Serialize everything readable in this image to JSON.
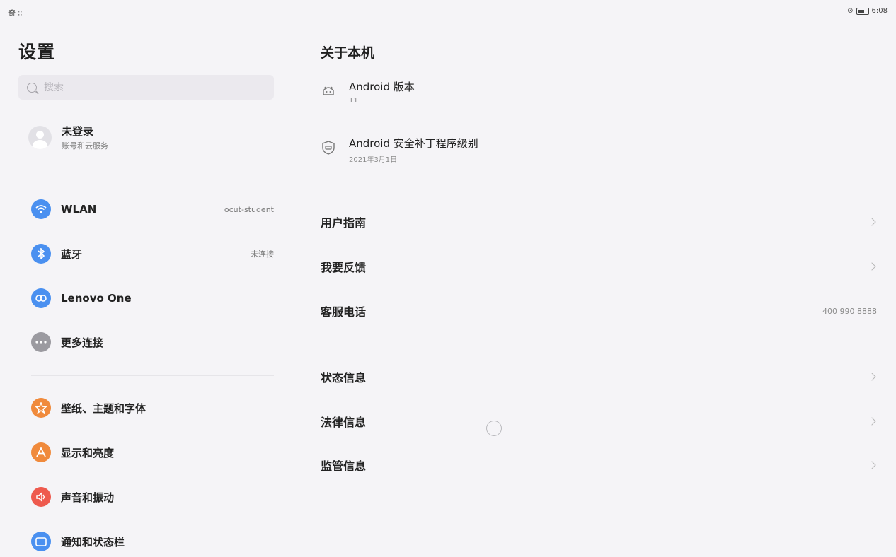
{
  "status_bar": {
    "left_text": "奇 ⁝⁝",
    "right_text": "6:08"
  },
  "left_pane": {
    "title": "设置",
    "search": {
      "placeholder": "搜索"
    },
    "account": {
      "name": "未登录",
      "subtitle": "账号和云服务"
    },
    "items": [
      {
        "label": "WLAN",
        "value": "ocut-student",
        "icon": "wifi-icon",
        "color": "#4a90f0"
      },
      {
        "label": "蓝牙",
        "value": "未连接",
        "icon": "bluetooth-icon",
        "color": "#4a90f0"
      },
      {
        "label": "Lenovo One",
        "value": "",
        "icon": "lenovo-one-icon",
        "color": "#4a90f0"
      },
      {
        "label": "更多连接",
        "value": "",
        "icon": "more-icon",
        "color": "#9b9aa0"
      },
      {
        "label": "壁纸、主题和字体",
        "value": "",
        "icon": "theme-icon",
        "color": "#f08a3c"
      },
      {
        "label": "显示和亮度",
        "value": "",
        "icon": "display-icon",
        "color": "#f08a3c"
      },
      {
        "label": "声音和振动",
        "value": "",
        "icon": "sound-icon",
        "color": "#ee5a4e"
      },
      {
        "label": "通知和状态栏",
        "value": "",
        "icon": "notification-icon",
        "color": "#4a90f0"
      }
    ]
  },
  "right_pane": {
    "title": "关于本机",
    "info": [
      {
        "title": "Android 版本",
        "subtitle": "11",
        "icon": "android-icon"
      },
      {
        "title": "Android 安全补丁程序级别",
        "subtitle": "2021年3月1日",
        "icon": "shield-icon"
      }
    ],
    "rows": [
      {
        "label": "用户指南",
        "value": "",
        "has_chevron": true
      },
      {
        "label": "我要反馈",
        "value": "",
        "has_chevron": true
      },
      {
        "label": "客服电话",
        "value": "400 990 8888",
        "has_chevron": false
      },
      {
        "label": "状态信息",
        "value": "",
        "has_chevron": true
      },
      {
        "label": "法律信息",
        "value": "",
        "has_chevron": true
      },
      {
        "label": "监管信息",
        "value": "",
        "has_chevron": true
      }
    ]
  }
}
